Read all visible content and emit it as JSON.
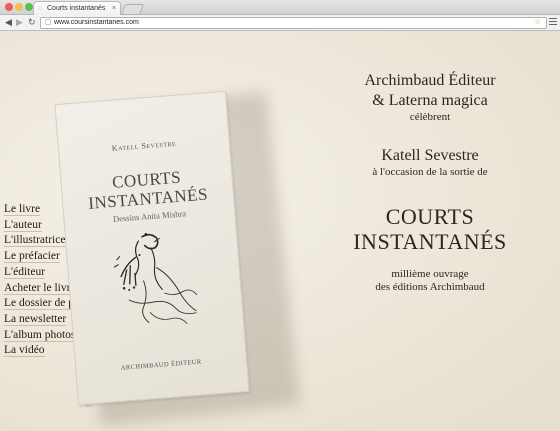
{
  "browser": {
    "tab_title": "Courts instantanés",
    "tab_close": "×",
    "url": "www.coursinstantanes.com",
    "nav_back": "◀",
    "nav_forward": "▶",
    "nav_reload": "↻",
    "star": "☆"
  },
  "sidebar": {
    "items": [
      {
        "label": "Le livre"
      },
      {
        "label": "L'auteur"
      },
      {
        "label": "L'illustratrice"
      },
      {
        "label": "Le préfacier"
      },
      {
        "label": "L'éditeur"
      },
      {
        "label": "Acheter le livre"
      },
      {
        "label": "Le dossier de presse"
      },
      {
        "label": "La newsletter"
      },
      {
        "label": "L'album photos"
      },
      {
        "label": "La vidéo"
      }
    ]
  },
  "book": {
    "author": "Katell Sevestre",
    "title_line1": "COURTS",
    "title_line2": "INSTANTANÉS",
    "subtitle": "Dessins Anita Mishra",
    "publisher": "ARCHIMBAUD ÉDITEUR"
  },
  "announcement": {
    "line1": "Archimbaud Éditeur",
    "line2": "& Laterna magica",
    "line3": "célèbrent",
    "author": "Katell Sevestre",
    "occasion": "à l'occasion de la sortie de",
    "title_line1": "COURTS",
    "title_line2": "INSTANTANÉS",
    "milestone_line1": "millième ouvrage",
    "milestone_line2": "des éditions Archimbaud"
  }
}
